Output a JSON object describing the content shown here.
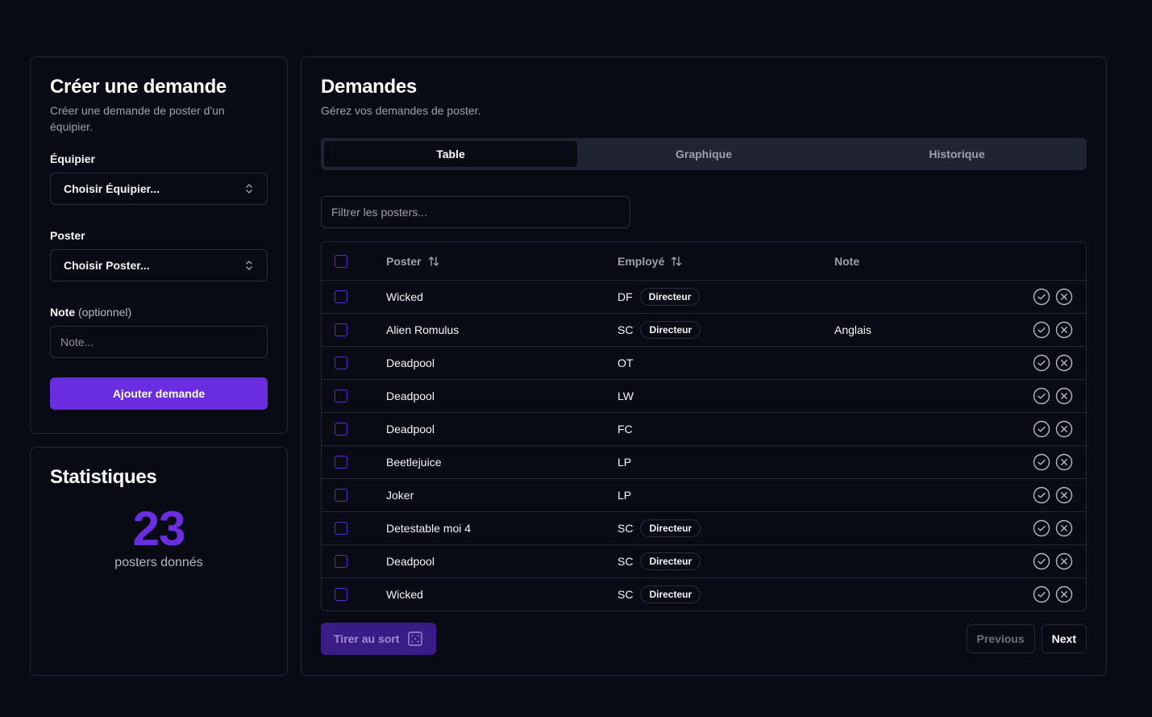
{
  "create": {
    "title": "Créer une demande",
    "description": "Créer une demande de poster d'un équipier.",
    "equipier_label": "Équipier",
    "equipier_value": "Choisir Équipier...",
    "poster_label": "Poster",
    "poster_value": "Choisir Poster...",
    "note_label": "Note",
    "note_optional": "(optionnel)",
    "note_placeholder": "Note...",
    "submit_label": "Ajouter demande"
  },
  "stats": {
    "title": "Statistiques",
    "count": "23",
    "count_label": "posters donnés"
  },
  "requests": {
    "title": "Demandes",
    "description": "Gérez vos demandes de poster.",
    "tabs": [
      {
        "label": "Table",
        "active": true
      },
      {
        "label": "Graphique",
        "active": false
      },
      {
        "label": "Historique",
        "active": false
      }
    ],
    "filter_placeholder": "Filtrer les posters...",
    "columns": {
      "poster": "Poster",
      "employee": "Employé",
      "note": "Note"
    },
    "rows": [
      {
        "poster": "Wicked",
        "employee": "DF",
        "badge": "Directeur",
        "note": ""
      },
      {
        "poster": "Alien Romulus",
        "employee": "SC",
        "badge": "Directeur",
        "note": "Anglais"
      },
      {
        "poster": "Deadpool",
        "employee": "OT",
        "badge": "",
        "note": ""
      },
      {
        "poster": "Deadpool",
        "employee": "LW",
        "badge": "",
        "note": ""
      },
      {
        "poster": "Deadpool",
        "employee": "FC",
        "badge": "",
        "note": ""
      },
      {
        "poster": "Beetlejuice",
        "employee": "LP",
        "badge": "",
        "note": ""
      },
      {
        "poster": "Joker",
        "employee": "LP",
        "badge": "",
        "note": ""
      },
      {
        "poster": "Detestable moi 4",
        "employee": "SC",
        "badge": "Directeur",
        "note": ""
      },
      {
        "poster": "Deadpool",
        "employee": "SC",
        "badge": "Directeur",
        "note": ""
      },
      {
        "poster": "Wicked",
        "employee": "SC",
        "badge": "Directeur",
        "note": ""
      }
    ],
    "draw_label": "Tirer au sort",
    "previous_label": "Previous",
    "next_label": "Next"
  },
  "colors": {
    "accent": "#6a2ee0",
    "background": "#090b14",
    "border": "#242835"
  }
}
